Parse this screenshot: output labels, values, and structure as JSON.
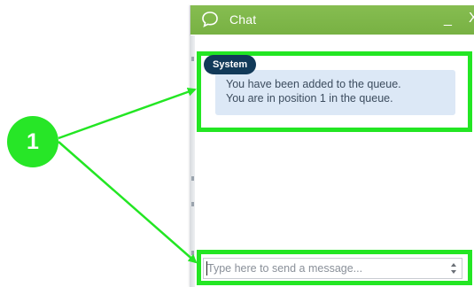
{
  "chat": {
    "title": "Chat",
    "minimize_label": "_",
    "close_label": "X",
    "icon": "speech-bubble-icon"
  },
  "message": {
    "sender": "System",
    "line_1": "You have been added to the queue.",
    "line_2": "You are in position 1 in the queue."
  },
  "composer": {
    "placeholder": "Type here to send a message...",
    "value": ""
  },
  "callout": {
    "number": "1"
  },
  "colors": {
    "header": "#7fb84a",
    "highlight": "#23e623",
    "badge": "#123a59",
    "bubble": "#dce8f6"
  }
}
